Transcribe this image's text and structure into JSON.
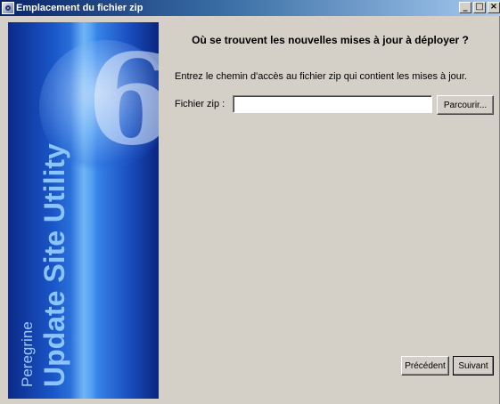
{
  "window": {
    "title": "Emplacement du fichier zip",
    "minimize_label": "_",
    "maximize_label": "□",
    "close_label": "×"
  },
  "banner": {
    "company": "Peregrine",
    "product": "Update Site Utility",
    "version_glyph": "6"
  },
  "main": {
    "heading": "Où se trouvent les nouvelles mises à jour à déployer ?",
    "description": "Entrez le chemin d'accès au fichier zip qui contient les mises à jour.",
    "field_label": "Fichier zip :",
    "field_value": "",
    "browse_label": "Parcourir..."
  },
  "footer": {
    "prev_label": "Précédent",
    "next_label": "Suivant"
  },
  "colors": {
    "dialog_bg": "#d4d0c8",
    "titlebar_start": "#0a246a",
    "titlebar_end": "#a6caf0",
    "banner_blue": "#1a56c8"
  },
  "icons": [
    "app-icon",
    "minimize-icon",
    "maximize-icon",
    "close-icon"
  ]
}
